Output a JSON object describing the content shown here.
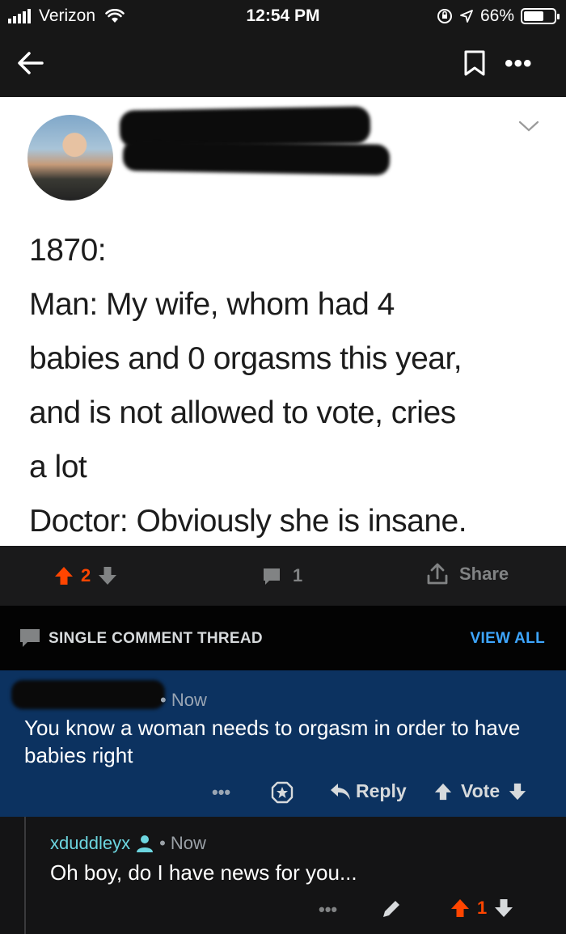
{
  "status_bar": {
    "carrier": "Verizon",
    "time": "12:54 PM",
    "battery_percent": "66%",
    "battery_level": 0.66
  },
  "nav": {
    "back_icon": "back-arrow-icon",
    "bookmark_icon": "bookmark-icon",
    "more_icon": "more-icon"
  },
  "post": {
    "tweet_text": "1870:\nMan: My wife, whom had 4\nbabies and 0 orgasms this year,\nand is not allowed to vote, cries\na lot\nDoctor: Obviously she is insane.",
    "score": "2",
    "comment_count": "1",
    "share_label": "Share"
  },
  "thread": {
    "title": "SINGLE COMMENT THREAD",
    "view_all": "VIEW ALL"
  },
  "comments": [
    {
      "time": "Now",
      "body": "You know a woman needs to orgasm in order to have babies right",
      "reply_label": "Reply",
      "vote_label": "Vote"
    },
    {
      "username": "xduddleyx",
      "time": "Now",
      "body": "Oh boy, do I have news for you...",
      "score": "1"
    }
  ],
  "colors": {
    "upvote": "#ff4500",
    "link": "#3ea6ff",
    "highlight_bg": "#0c3260",
    "op_username": "#6dd6e0"
  }
}
